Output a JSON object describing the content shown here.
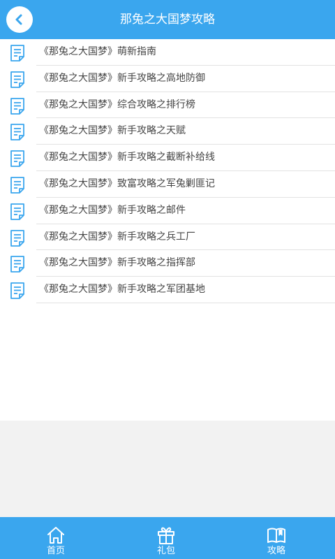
{
  "header": {
    "title": "那兔之大国梦攻略",
    "back_icon": "chevron-left-icon",
    "color": "#3aa6ee"
  },
  "list": {
    "item_icon": "document-icon",
    "items": [
      {
        "label": "《那兔之大国梦》萌新指南"
      },
      {
        "label": "《那兔之大国梦》新手攻略之高地防御"
      },
      {
        "label": "《那兔之大国梦》综合攻略之排行榜"
      },
      {
        "label": "《那兔之大国梦》新手攻略之天赋"
      },
      {
        "label": "《那兔之大国梦》新手攻略之截断补给线"
      },
      {
        "label": "《那兔之大国梦》致富攻略之军兔剿匪记"
      },
      {
        "label": "《那兔之大国梦》新手攻略之邮件"
      },
      {
        "label": "《那兔之大国梦》新手攻略之兵工厂"
      },
      {
        "label": "《那兔之大国梦》新手攻略之指挥部"
      },
      {
        "label": "《那兔之大国梦》新手攻略之军团基地"
      }
    ]
  },
  "tabbar": {
    "tabs": [
      {
        "label": "首页",
        "icon": "home-icon"
      },
      {
        "label": "礼包",
        "icon": "gift-icon"
      },
      {
        "label": "攻略",
        "icon": "book-icon"
      }
    ]
  }
}
